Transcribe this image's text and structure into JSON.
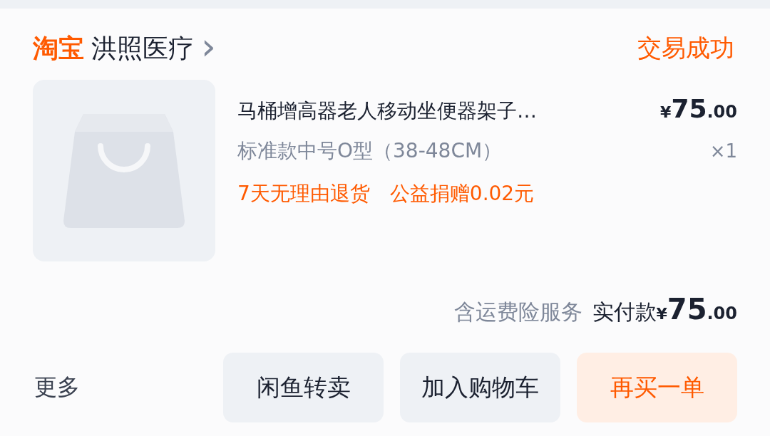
{
  "shop": {
    "platform": "淘宝",
    "name": "洪照医疗",
    "chevron": "›"
  },
  "order_status": "交易成功",
  "item": {
    "title": "马桶增高器老人移动坐便器架子…",
    "variant": "标准款中号O型（38-48CM）",
    "price": {
      "currency": "¥",
      "whole": "75",
      "fraction": ".00"
    },
    "quantity": "×1",
    "tags": [
      "7天无理由退货",
      "公益捐赠0.02元"
    ]
  },
  "summary": {
    "note": "含运费险服务",
    "label": "实付款",
    "price": {
      "currency": "¥",
      "whole": "75",
      "fraction": ".00"
    }
  },
  "more": "更多",
  "buttons": [
    {
      "label": "闲鱼转卖",
      "kind": "secondary"
    },
    {
      "label": "加入购物车",
      "kind": "secondary"
    },
    {
      "label": "再买一单",
      "kind": "primary"
    }
  ]
}
